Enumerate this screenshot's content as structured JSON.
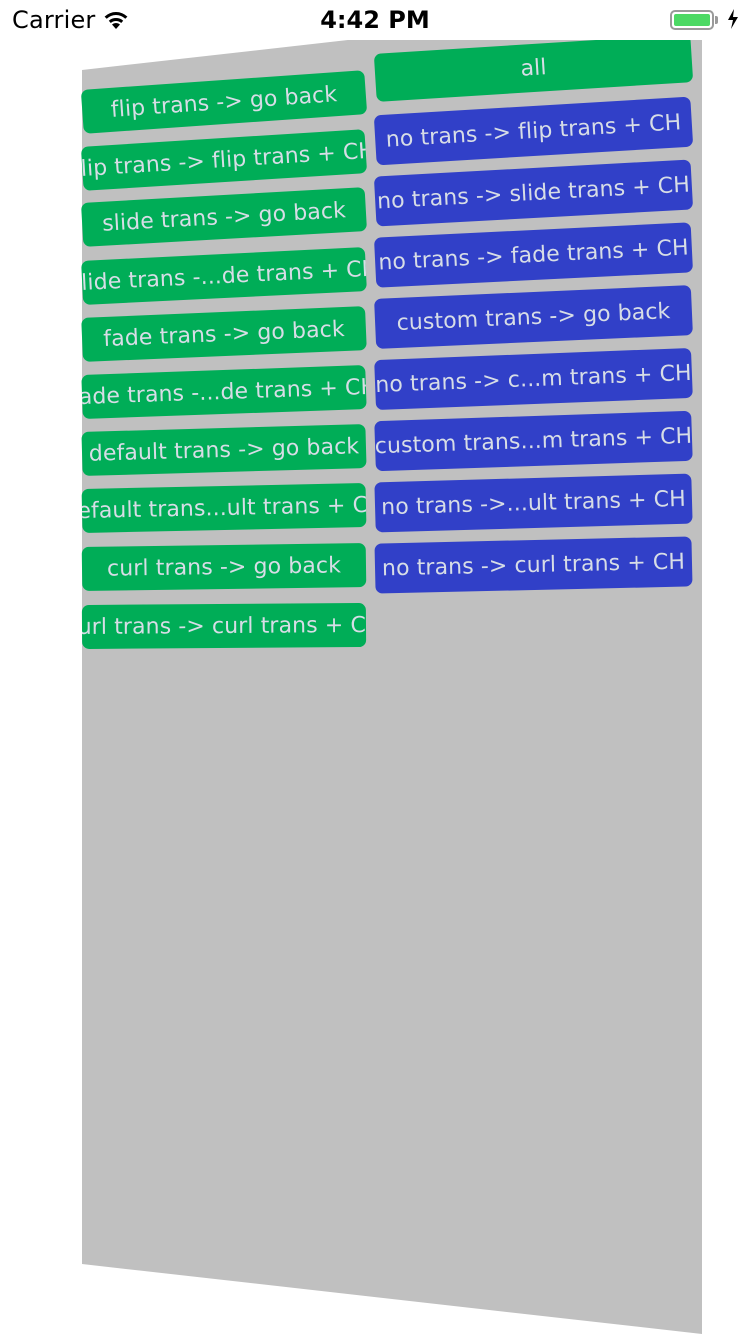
{
  "status_bar": {
    "carrier": "Carrier",
    "time": "4:42 PM",
    "battery_level": 1.0,
    "charging": true
  },
  "colors": {
    "panel": "#c0c0c0",
    "green_button": "#00ad57",
    "blue_button": "#3140c8",
    "button_text": "#d7dde6"
  },
  "left_column": [
    "flip trans -> go back",
    "flip trans -> flip trans + CH",
    "slide trans -> go back",
    "slide trans -...de trans + CH",
    "fade trans -> go back",
    "fade trans -...de trans + CH",
    "default trans -> go back",
    "default trans...ult trans + CH",
    "curl trans -> go back",
    "curl trans -> curl trans + CH"
  ],
  "right_column": {
    "all_label": "all",
    "items": [
      "no trans -> flip trans + CH",
      "no trans -> slide trans + CH",
      "no trans -> fade trans + CH",
      "custom trans -> go back",
      "no trans -> c...m trans + CH",
      "custom trans...m trans + CH",
      "no trans ->...ult trans + CH",
      "no trans -> curl trans + CH"
    ]
  }
}
